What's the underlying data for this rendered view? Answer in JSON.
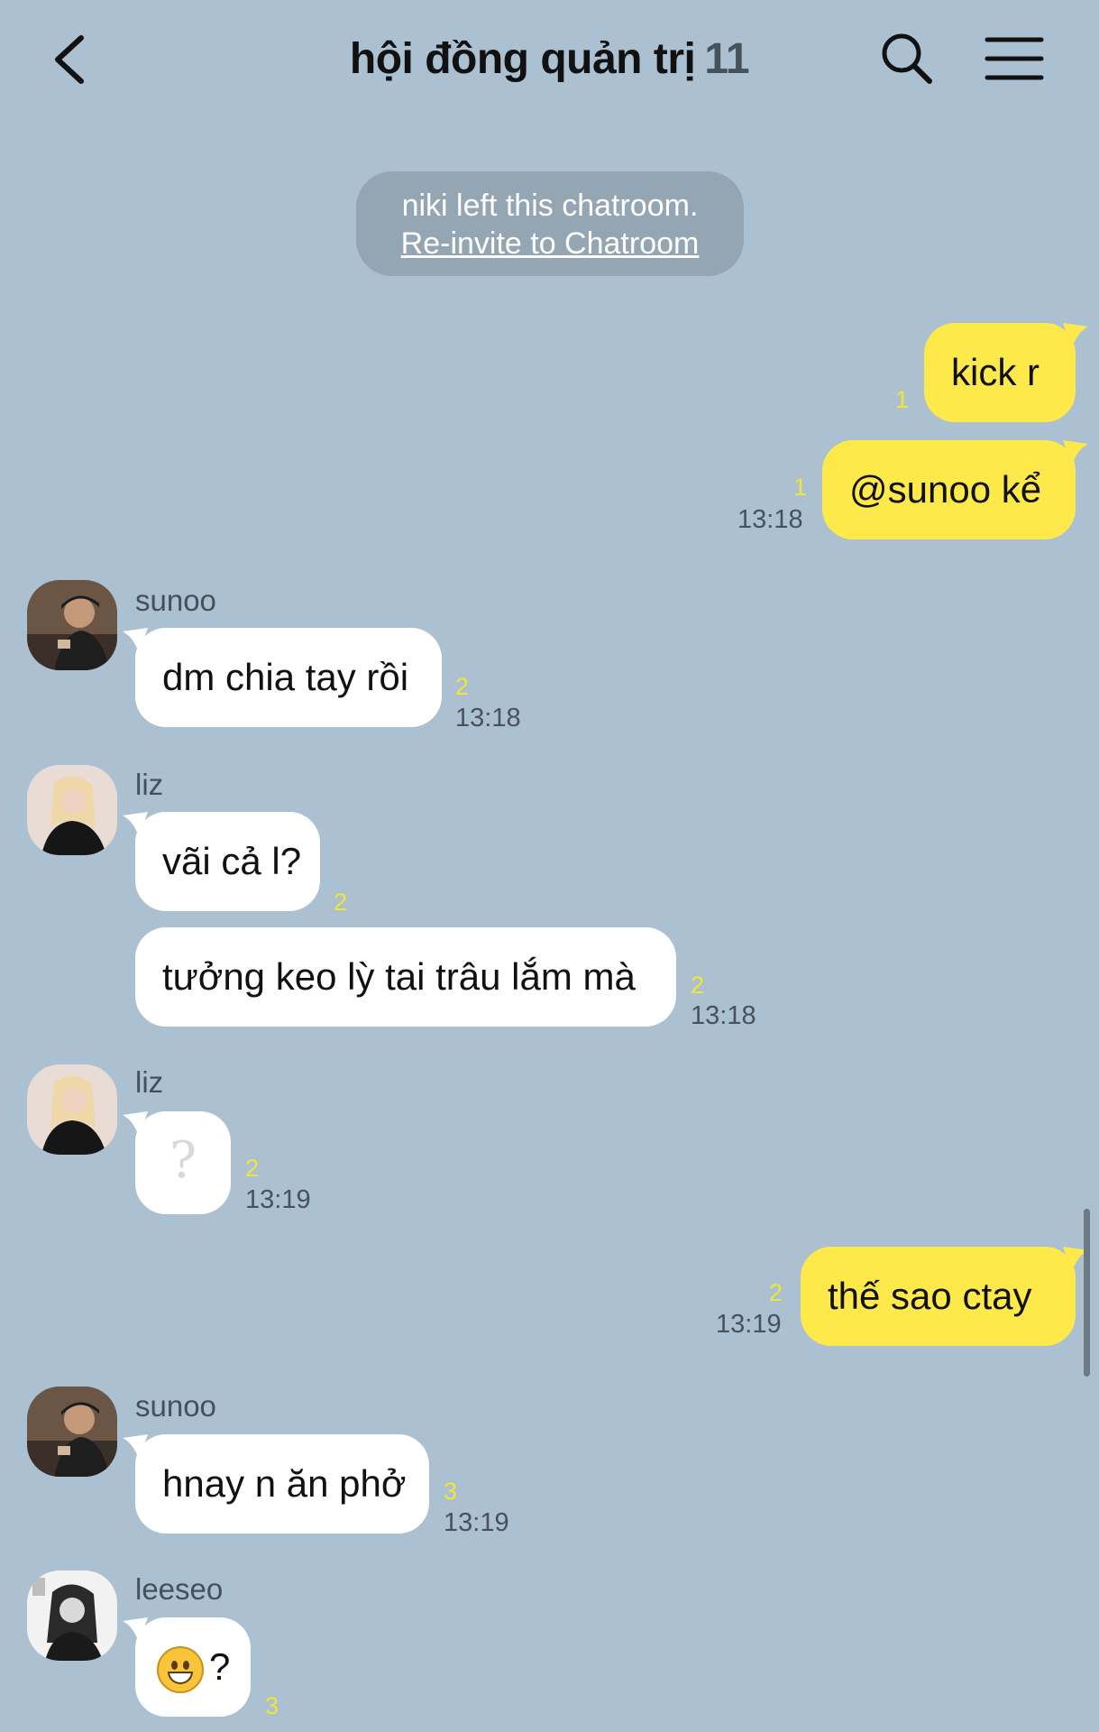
{
  "header": {
    "title": "hội đồng quản trị",
    "member_count": "11"
  },
  "system_notice": {
    "text": "niki left this chatroom.",
    "link": "Re-invite to Chatroom"
  },
  "messages": [
    {
      "text": "kick r",
      "unread": "1"
    },
    {
      "text": "@sunoo kể",
      "unread": "1",
      "time": "13:18"
    },
    {
      "sender": "sunoo",
      "text": "dm chia tay rồi",
      "unread": "2",
      "time": "13:18"
    },
    {
      "sender": "liz",
      "text": "vãi cả l?",
      "unread": "2"
    },
    {
      "text": "tưởng keo lỳ tai trâu lắm mà",
      "unread": "2",
      "time": "13:18"
    },
    {
      "sender": "liz",
      "text": "?",
      "unread": "2",
      "time": "13:19"
    },
    {
      "text": "thế sao ctay",
      "unread": "2",
      "time": "13:19"
    },
    {
      "sender": "sunoo",
      "text": "hnay n ăn phở",
      "unread": "3",
      "time": "13:19"
    },
    {
      "sender": "leeseo",
      "text": "?",
      "unread": "3"
    }
  ],
  "colors": {
    "background": "#abc1d1",
    "my_bubble": "#fee94a",
    "other_bubble": "#ffffff",
    "unread_count": "#f2e535"
  },
  "icons": [
    "back-icon",
    "search-icon",
    "menu-icon",
    "grinning-face-emoji"
  ]
}
